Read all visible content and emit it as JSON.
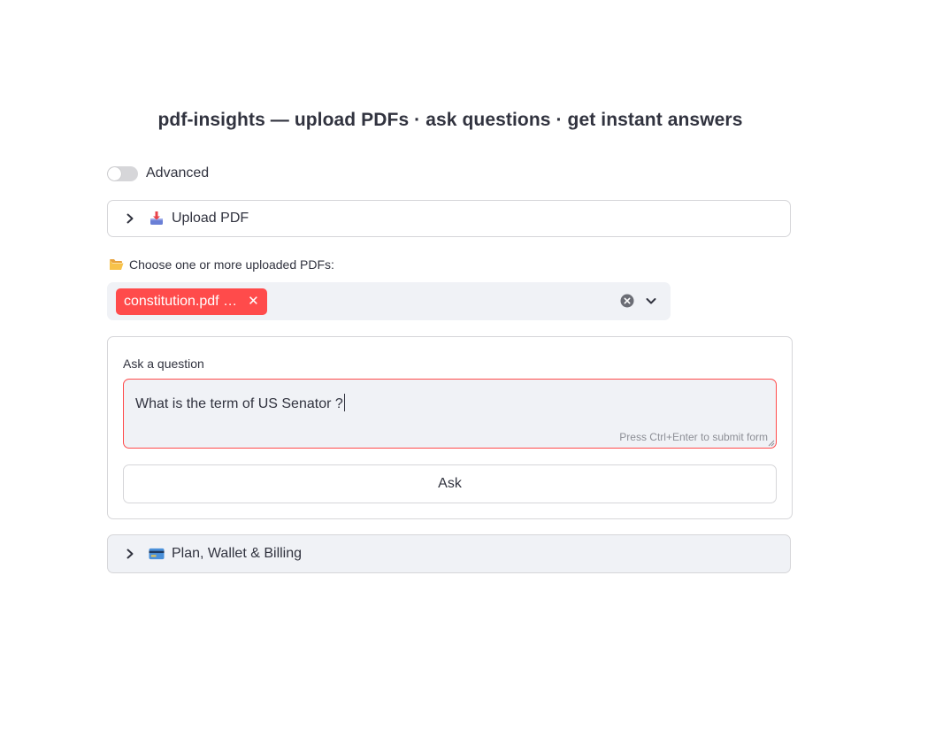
{
  "header": {
    "title": "pdf-insights — upload PDFs · ask questions · get instant answers"
  },
  "advanced_toggle": {
    "label": "Advanced",
    "checked": false
  },
  "upload_expander": {
    "label": "Upload PDF",
    "icon": "inbox-tray-icon"
  },
  "pdf_select": {
    "label": "Choose one or more uploaded PDFs:",
    "label_icon": "open-folder-icon",
    "selected": [
      {
        "label": "constitution.pdf …"
      }
    ]
  },
  "question_form": {
    "label": "Ask a question",
    "value": "What is the term of US Senator ?",
    "hint": "Press Ctrl+Enter to submit form",
    "submit_label": "Ask"
  },
  "billing_expander": {
    "label": "Plan, Wallet & Billing",
    "icon": "credit-card-icon"
  },
  "colors": {
    "accent": "#ff4b4b",
    "text": "#31333f",
    "input_bg": "#f0f2f6",
    "border": "#d6d6d9"
  }
}
